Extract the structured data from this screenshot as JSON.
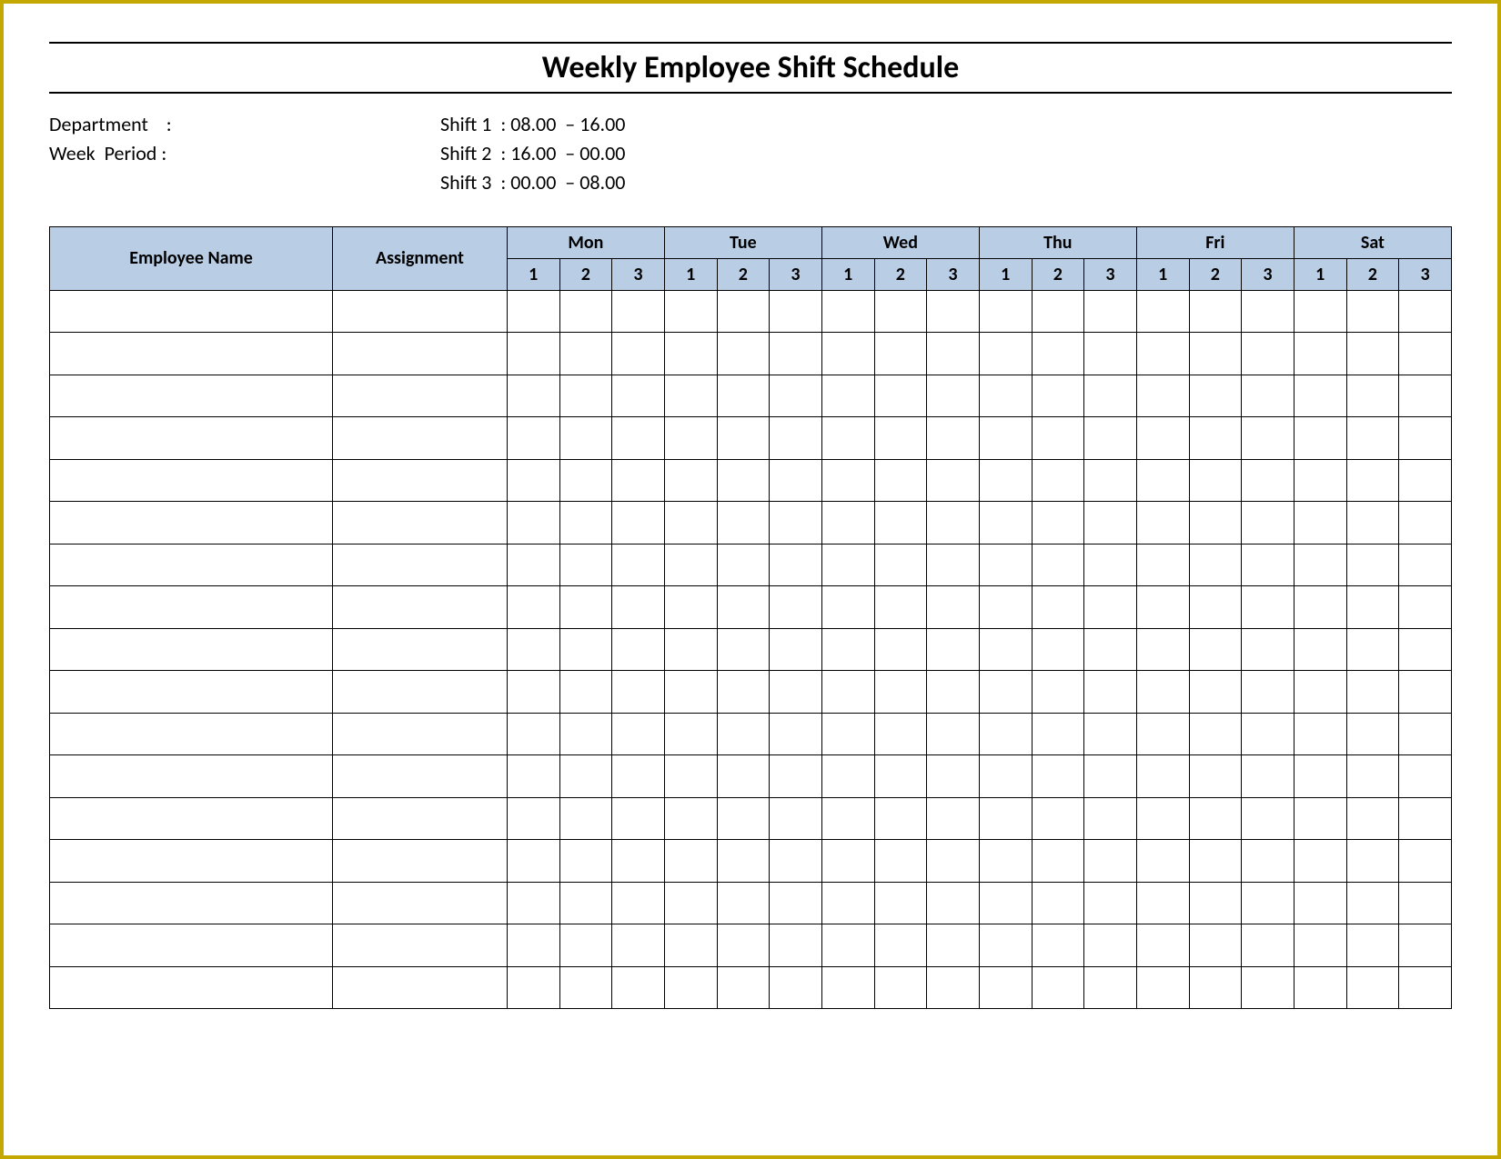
{
  "title": "Weekly Employee Shift Schedule",
  "meta": {
    "department_label": "Department    :",
    "week_period_label": "Week  Period :",
    "shift_lines": [
      "Shift 1  : 08.00  – 16.00",
      "Shift 2  : 16.00  – 00.00",
      "Shift 3  : 00.00  – 08.00"
    ]
  },
  "columns": {
    "employee_name": "Employee Name",
    "assignment": "Assignment",
    "days": [
      "Mon",
      "Tue",
      "Wed",
      "Thu",
      "Fri",
      "Sat"
    ],
    "sub_shifts": [
      "1",
      "2",
      "3"
    ]
  },
  "rows": [
    {
      "name": "",
      "assignment": "",
      "cells": [
        "",
        "",
        "",
        "",
        "",
        "",
        "",
        "",
        "",
        "",
        "",
        "",
        "",
        "",
        "",
        "",
        "",
        ""
      ]
    },
    {
      "name": "",
      "assignment": "",
      "cells": [
        "",
        "",
        "",
        "",
        "",
        "",
        "",
        "",
        "",
        "",
        "",
        "",
        "",
        "",
        "",
        "",
        "",
        ""
      ]
    },
    {
      "name": "",
      "assignment": "",
      "cells": [
        "",
        "",
        "",
        "",
        "",
        "",
        "",
        "",
        "",
        "",
        "",
        "",
        "",
        "",
        "",
        "",
        "",
        ""
      ]
    },
    {
      "name": "",
      "assignment": "",
      "cells": [
        "",
        "",
        "",
        "",
        "",
        "",
        "",
        "",
        "",
        "",
        "",
        "",
        "",
        "",
        "",
        "",
        "",
        ""
      ]
    },
    {
      "name": "",
      "assignment": "",
      "cells": [
        "",
        "",
        "",
        "",
        "",
        "",
        "",
        "",
        "",
        "",
        "",
        "",
        "",
        "",
        "",
        "",
        "",
        ""
      ]
    },
    {
      "name": "",
      "assignment": "",
      "cells": [
        "",
        "",
        "",
        "",
        "",
        "",
        "",
        "",
        "",
        "",
        "",
        "",
        "",
        "",
        "",
        "",
        "",
        ""
      ]
    },
    {
      "name": "",
      "assignment": "",
      "cells": [
        "",
        "",
        "",
        "",
        "",
        "",
        "",
        "",
        "",
        "",
        "",
        "",
        "",
        "",
        "",
        "",
        "",
        ""
      ]
    },
    {
      "name": "",
      "assignment": "",
      "cells": [
        "",
        "",
        "",
        "",
        "",
        "",
        "",
        "",
        "",
        "",
        "",
        "",
        "",
        "",
        "",
        "",
        "",
        ""
      ]
    },
    {
      "name": "",
      "assignment": "",
      "cells": [
        "",
        "",
        "",
        "",
        "",
        "",
        "",
        "",
        "",
        "",
        "",
        "",
        "",
        "",
        "",
        "",
        "",
        ""
      ]
    },
    {
      "name": "",
      "assignment": "",
      "cells": [
        "",
        "",
        "",
        "",
        "",
        "",
        "",
        "",
        "",
        "",
        "",
        "",
        "",
        "",
        "",
        "",
        "",
        ""
      ]
    },
    {
      "name": "",
      "assignment": "",
      "cells": [
        "",
        "",
        "",
        "",
        "",
        "",
        "",
        "",
        "",
        "",
        "",
        "",
        "",
        "",
        "",
        "",
        "",
        ""
      ]
    },
    {
      "name": "",
      "assignment": "",
      "cells": [
        "",
        "",
        "",
        "",
        "",
        "",
        "",
        "",
        "",
        "",
        "",
        "",
        "",
        "",
        "",
        "",
        "",
        ""
      ]
    },
    {
      "name": "",
      "assignment": "",
      "cells": [
        "",
        "",
        "",
        "",
        "",
        "",
        "",
        "",
        "",
        "",
        "",
        "",
        "",
        "",
        "",
        "",
        "",
        ""
      ]
    },
    {
      "name": "",
      "assignment": "",
      "cells": [
        "",
        "",
        "",
        "",
        "",
        "",
        "",
        "",
        "",
        "",
        "",
        "",
        "",
        "",
        "",
        "",
        "",
        ""
      ]
    },
    {
      "name": "",
      "assignment": "",
      "cells": [
        "",
        "",
        "",
        "",
        "",
        "",
        "",
        "",
        "",
        "",
        "",
        "",
        "",
        "",
        "",
        "",
        "",
        ""
      ]
    },
    {
      "name": "",
      "assignment": "",
      "cells": [
        "",
        "",
        "",
        "",
        "",
        "",
        "",
        "",
        "",
        "",
        "",
        "",
        "",
        "",
        "",
        "",
        "",
        ""
      ]
    },
    {
      "name": "",
      "assignment": "",
      "cells": [
        "",
        "",
        "",
        "",
        "",
        "",
        "",
        "",
        "",
        "",
        "",
        "",
        "",
        "",
        "",
        "",
        "",
        ""
      ]
    }
  ]
}
